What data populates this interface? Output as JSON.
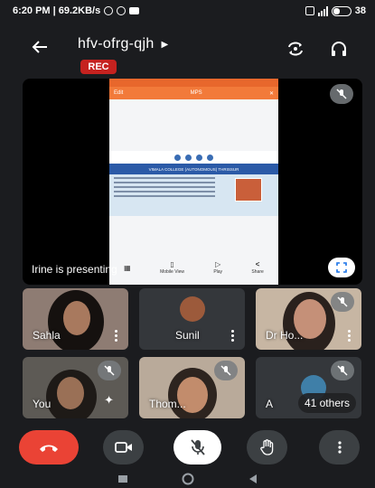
{
  "status_bar": {
    "time_speed": "6:20 PM | 69.2KB/s",
    "battery": "38",
    "battery_level": 0.38
  },
  "header": {
    "meeting_code": "hfv-ofrg-qjh",
    "recording_badge": "REC"
  },
  "presentation": {
    "presenter_label": "Irine is presenting",
    "shared_app": {
      "back_label": "Edit",
      "logo_text": "MPS",
      "banner_text": "VIMALA COLLEGE (AUTONOMOUS) THRISSUR",
      "bottom_items": [
        "Mobile View",
        "Play",
        "Share"
      ]
    }
  },
  "participants": [
    {
      "name": "Sahla"
    },
    {
      "name": "Sunil"
    },
    {
      "name": "Dr Ho..."
    },
    {
      "name": "You"
    },
    {
      "name": "Thom..."
    },
    {
      "name": "A",
      "others_label": "41 others"
    }
  ],
  "icons": {
    "back": "arrow-left-icon",
    "switch_camera": "switch-camera-icon",
    "audio": "headphones-icon",
    "mic_off": "mic-off-icon",
    "fullscreen": "fullscreen-icon",
    "hang_up": "hang-up-icon",
    "camera": "video-camera-icon",
    "raise_hand": "hand-icon",
    "more": "more-vert-icon"
  },
  "colors": {
    "hang_up": "#ea4335",
    "rec": "#c5221f",
    "tile": "#34373b",
    "control": "#3c4043"
  }
}
